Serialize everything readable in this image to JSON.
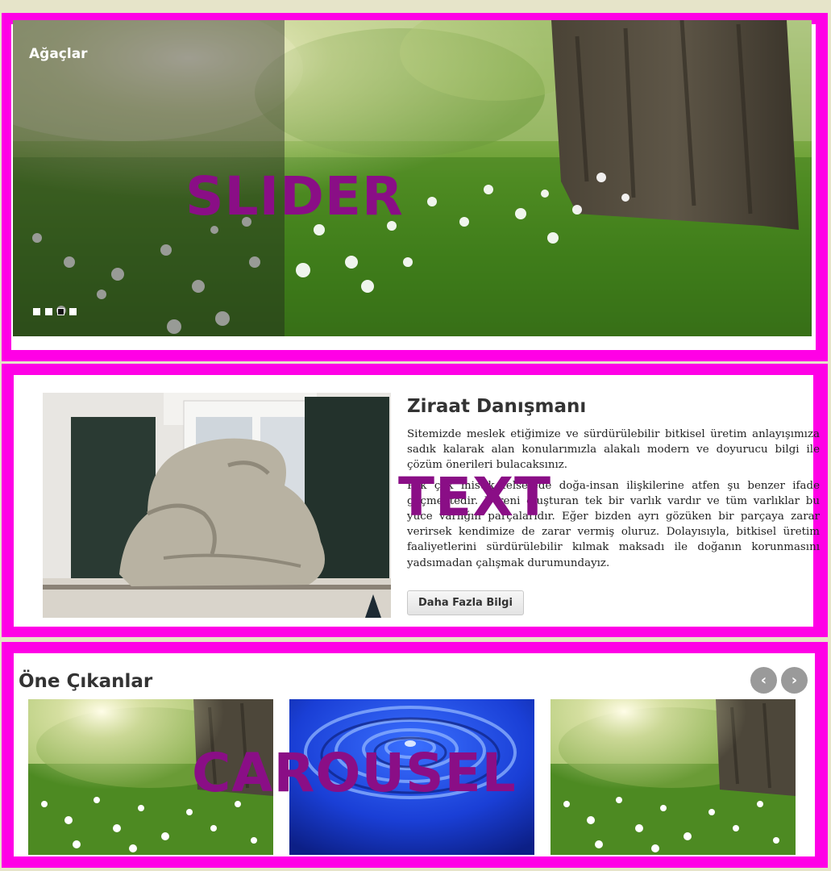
{
  "slider": {
    "label": "SLIDER",
    "caption": "Ağaçlar",
    "dots": [
      {
        "active": false
      },
      {
        "active": false
      },
      {
        "active": true
      },
      {
        "active": false
      }
    ]
  },
  "text_section": {
    "label": "TEXT",
    "title": "Ziraat Danışmanı",
    "paragraphs": [
      "Sitemizde meslek etiğimize ve sürdürülebilir bitkisel üretim anlayışımıza sadık kalarak  alan konularımızla alakalı modern ve doyurucu bilgi ile çözüm önerileri bulacaksınız.",
      "Pek çok mistik felsefede doğa-insan ilişkilerine atfen şu benzer ifade geçmektedir. Evreni oluşturan tek bir varlık vardır ve tüm varlıklar bu yüce varlığın parçalarıdır. Eğer bizden ayrı gözüken bir parçaya zarar verirsek kendimize de zarar vermiş oluruz. Dolayısıyla, bitkisel üretim faaliyetlerini sürdürülebilir kılmak maksadı ile doğanın korunmasını yadsımadan çalışmak durumundayız."
    ],
    "button_label": "Daha Fazla Bilgi"
  },
  "carousel": {
    "label": "CAROUSEL",
    "title": "Öne Çıkanlar",
    "prev_icon": "‹",
    "next_icon": "›",
    "items": [
      {
        "image": "forest-tree-meadow"
      },
      {
        "image": "water-ripple"
      },
      {
        "image": "forest-tree-meadow"
      }
    ]
  },
  "colors": {
    "frame_magenta": "#ff00e6",
    "label_purple": "#8a0e86",
    "page_background": "#e6e4c9"
  }
}
